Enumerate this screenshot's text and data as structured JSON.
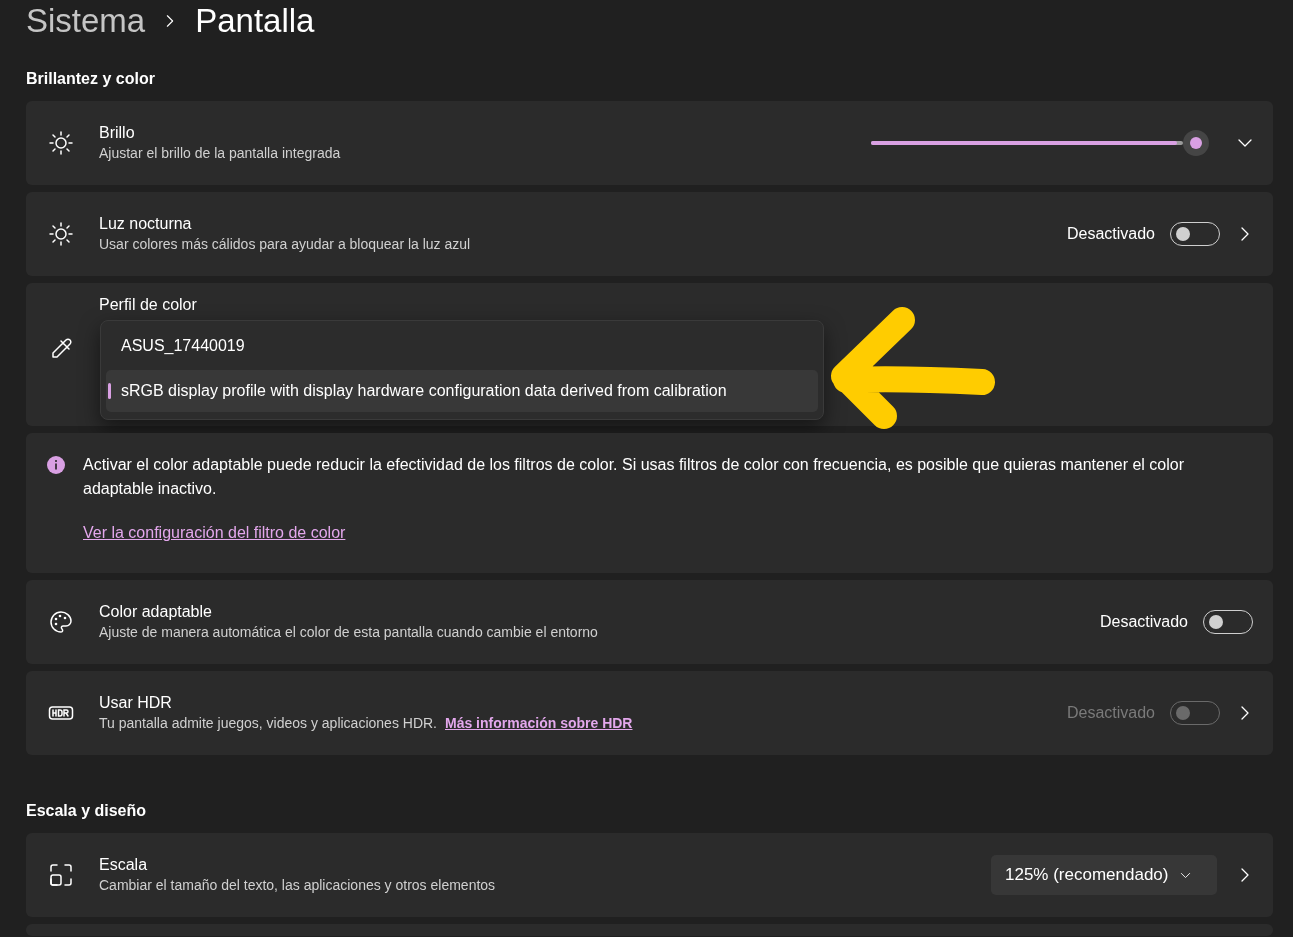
{
  "breadcrumb": {
    "parent": "Sistema",
    "current": "Pantalla"
  },
  "sections": [
    {
      "title": "Brillantez y color",
      "rows": [
        {
          "kind": "slider",
          "title": "Brillo",
          "subtitle": "Ajustar el brillo de la pantalla integrada",
          "level": 0.98,
          "expanded": false
        },
        {
          "kind": "toggle",
          "title": "Luz nocturna",
          "subtitle": "Usar colores más cálidos para ayudar a bloquear la luz azul",
          "status": "Desactivado",
          "on": false,
          "disabled": false,
          "navigates": true
        },
        {
          "kind": "dropdown",
          "title": "Perfil de color",
          "options": [
            {
              "label": "ASUS_17440019",
              "selected": false
            },
            {
              "label": "sRGB display profile with display hardware configuration data derived from calibration",
              "selected": true
            }
          ]
        },
        {
          "kind": "info",
          "text": "Activar el color adaptable puede reducir la efectividad de los filtros de color. Si usas filtros de color con frecuencia, es posible que quieras mantener el color adaptable inactivo.",
          "link": "Ver la configuración del filtro de color"
        },
        {
          "kind": "toggle",
          "title": "Color adaptable",
          "subtitle": "Ajuste de manera automática el color de esta pantalla cuando cambie el entorno",
          "status": "Desactivado",
          "on": false,
          "disabled": false,
          "navigates": false
        },
        {
          "kind": "toggle",
          "title": "Usar HDR",
          "subtitle": "Tu pantalla admite juegos, videos y aplicaciones HDR.",
          "link": "Más información sobre HDR",
          "status": "Desactivado",
          "on": false,
          "disabled": true,
          "navigates": true
        }
      ]
    },
    {
      "title": "Escala y diseño",
      "rows": [
        {
          "kind": "select",
          "title": "Escala",
          "subtitle": "Cambiar el tamaño del texto, las aplicaciones y otros elementos",
          "value": "125% (recomendado)",
          "navigates": true
        }
      ]
    }
  ]
}
